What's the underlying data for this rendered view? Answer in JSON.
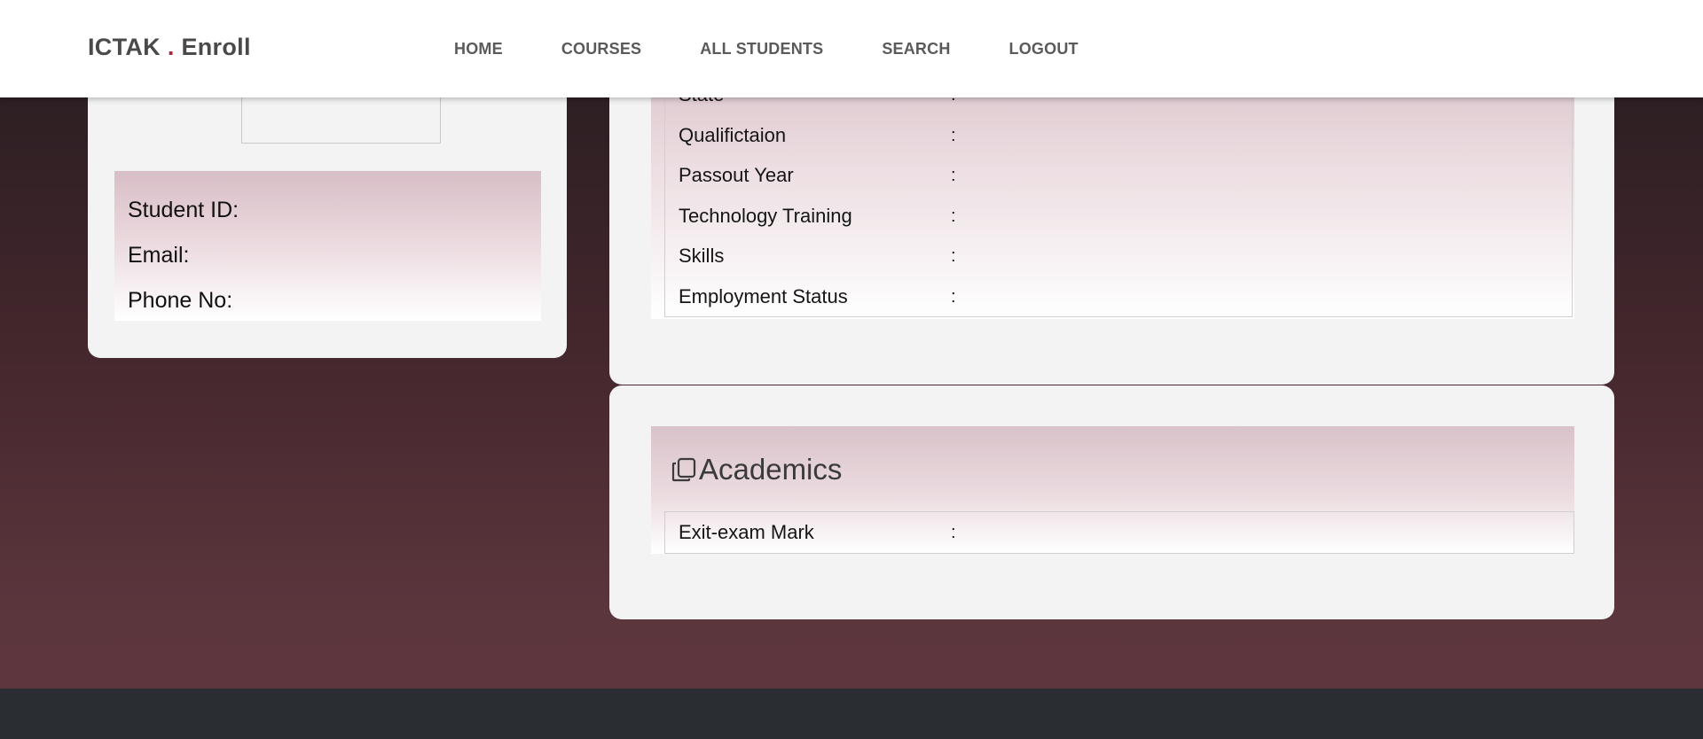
{
  "navbar": {
    "brand_main": "ICTAK",
    "brand_dot": ".",
    "brand_sub": "Enroll",
    "links": [
      "HOME",
      "COURSES",
      "ALL STUDENTS",
      "SEARCH",
      "LOGOUT"
    ]
  },
  "profile": {
    "student_id_label": "Student ID:",
    "email_label": "Email:",
    "phone_label": "Phone No:"
  },
  "personal": {
    "fields": [
      {
        "label": "State",
        "sep": ":"
      },
      {
        "label": "Qualifictaion",
        "sep": ":"
      },
      {
        "label": "Passout Year",
        "sep": ":"
      },
      {
        "label": "Technology Training",
        "sep": ":"
      },
      {
        "label": "Skills",
        "sep": ":"
      },
      {
        "label": "Employment Status",
        "sep": ":"
      }
    ]
  },
  "academics": {
    "title": "Academics",
    "icon": "copy-icon",
    "fields": [
      {
        "label": "Exit-exam Mark",
        "sep": ":"
      }
    ]
  },
  "colors": {
    "accent_dot": "#b1263b",
    "panel_pink": "#d9c2c9",
    "footer": "#2a2d31"
  }
}
